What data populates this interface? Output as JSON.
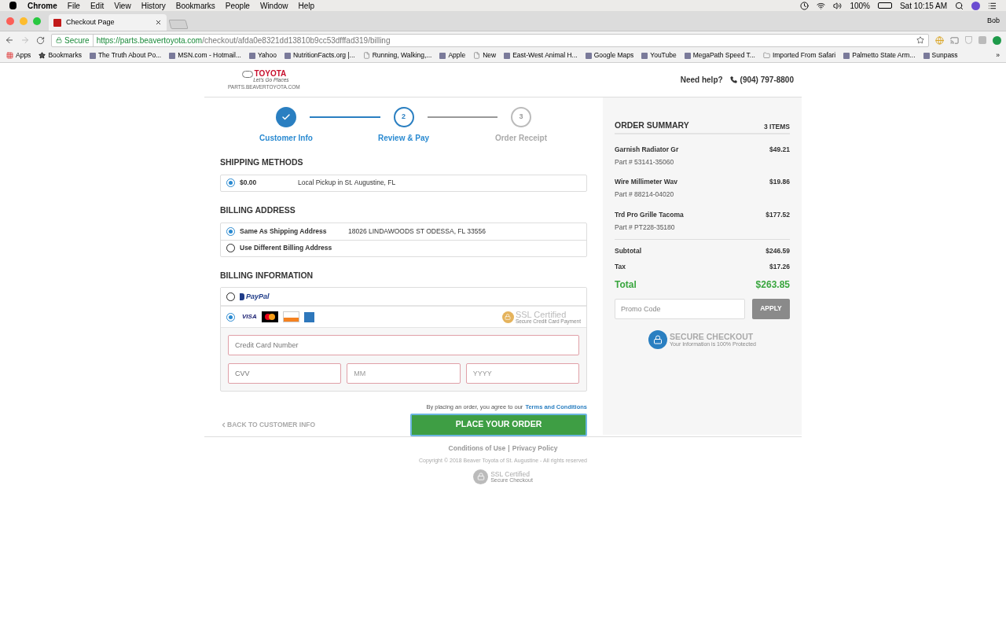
{
  "menubar": {
    "items": [
      "Chrome",
      "File",
      "Edit",
      "View",
      "History",
      "Bookmarks",
      "People",
      "Window",
      "Help"
    ],
    "battery": "100%",
    "clock": "Sat 10:15 AM"
  },
  "browser": {
    "tab_title": "Checkout Page",
    "profile": "Bob",
    "secure_label": "Secure",
    "url_host": "https://parts.beavertoyota.com",
    "url_path": "/checkout/afda0e8321dd13810b9cc53dfffad319/billing",
    "bookmarks": [
      {
        "kind": "apps",
        "label": "Apps"
      },
      {
        "kind": "star",
        "label": "Bookmarks"
      },
      {
        "kind": "site",
        "label": "The Truth About Po..."
      },
      {
        "kind": "site",
        "label": "MSN.com - Hotmail..."
      },
      {
        "kind": "site",
        "label": "Yahoo"
      },
      {
        "kind": "site",
        "label": "NutritionFacts.org |..."
      },
      {
        "kind": "page",
        "label": "Running, Walking,..."
      },
      {
        "kind": "site",
        "label": "Apple"
      },
      {
        "kind": "page",
        "label": "New"
      },
      {
        "kind": "site",
        "label": "East-West Animal H..."
      },
      {
        "kind": "site",
        "label": "Google Maps"
      },
      {
        "kind": "site",
        "label": "YouTube"
      },
      {
        "kind": "site",
        "label": "MegaPath Speed T..."
      },
      {
        "kind": "folder",
        "label": "Imported From Safari"
      },
      {
        "kind": "site",
        "label": "Palmetto State Arm..."
      },
      {
        "kind": "site",
        "label": "Sunpass"
      }
    ],
    "more": "»"
  },
  "header": {
    "brand": "TOYOTA",
    "tagline": "Let's Go Places",
    "site": "PARTS.BEAVERTOYOTA.COM",
    "help": "Need help?",
    "phone": "(904) 797-8800"
  },
  "steps": [
    {
      "label": "Customer Info",
      "completed": true,
      "active": false
    },
    {
      "number": "2",
      "label": "Review & Pay",
      "completed": false,
      "active": true
    },
    {
      "number": "3",
      "label": "Order Receipt",
      "completed": false,
      "active": false
    }
  ],
  "shipping": {
    "title": "SHIPPING METHODS",
    "options": [
      {
        "price": "$0.00",
        "label": "Local Pickup in St. Augustine, FL",
        "selected": true
      }
    ]
  },
  "billing_address": {
    "title": "BILLING ADDRESS",
    "options": [
      {
        "label": "Same As Shipping Address",
        "detail": "18026 LINDAWOODS ST ODESSA, FL 33556",
        "selected": true
      },
      {
        "label": "Use Different Billing Address",
        "selected": false
      }
    ]
  },
  "billing_info": {
    "title": "BILLING INFORMATION",
    "methods": [
      {
        "kind": "paypal",
        "label": "PayPal",
        "selected": false
      },
      {
        "kind": "cards",
        "visa": "VISA",
        "ssl_title": "SSL Certified",
        "ssl_sub": "Secure Credit Card Payment",
        "selected": true
      }
    ],
    "card_number": {
      "placeholder": "Credit Card Number"
    },
    "cvv": {
      "placeholder": "CVV"
    },
    "month": {
      "placeholder": "MM"
    },
    "year": {
      "placeholder": "YYYY"
    }
  },
  "agreement": {
    "text": "By placing an order, you agree to our",
    "link": "Terms and Conditions"
  },
  "back_link": "BACK TO CUSTOMER INFO",
  "place_order": "PLACE YOUR ORDER",
  "summary": {
    "title": "ORDER SUMMARY",
    "count": "3 ITEMS",
    "items": [
      {
        "name": "Garnish Radiator Gr",
        "part": "Part # 53141-35060",
        "price": "$49.21"
      },
      {
        "name": "Wire Millimeter Wav",
        "part": "Part # 88214-04020",
        "price": "$19.86"
      },
      {
        "name": "Trd Pro Grille Tacoma",
        "part": "Part # PT228-35180",
        "price": "$177.52"
      }
    ],
    "totals": [
      {
        "kind": "plain",
        "label": "Subtotal",
        "value": "$246.59"
      },
      {
        "kind": "plain",
        "label": "Tax",
        "value": "$17.26"
      },
      {
        "kind": "total",
        "label": "Total",
        "value": "$263.85"
      }
    ],
    "promo": {
      "placeholder": "Promo Code"
    },
    "apply": "APPLY",
    "secure_title": "SECURE CHECKOUT",
    "secure_sub": "Your Information is 100% Protected"
  },
  "footer": {
    "links": [
      "Conditions of Use",
      "Privacy Policy"
    ],
    "separator": "|",
    "copyright": "Copyright © 2018 Beaver Toyota of St. Augustine - All rights reserved",
    "ssl_title": "SSL Certified",
    "ssl_sub": "Secure Checkout"
  }
}
